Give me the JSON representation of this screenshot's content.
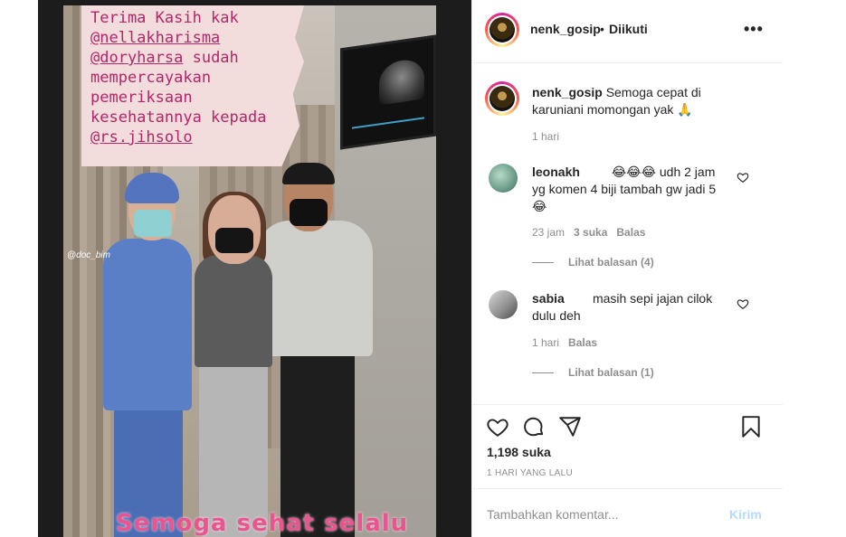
{
  "media": {
    "caption_lines": [
      "Terima Kasih kak",
      "@nellakharisma",
      "@doryharsa sudah",
      "mempercayakan",
      "pemeriksaan",
      "kesehatannya kepada",
      "@rs.jihsolo"
    ],
    "watermark": "@doc_bim",
    "bottom_text": "Semoga sehat selalu"
  },
  "header": {
    "username": "nenk_gosip",
    "separator": "•",
    "follow_status": "Diikuti",
    "more_icon": "more-horizontal-icon"
  },
  "caption": {
    "username": "nenk_gosip",
    "text": "Semoga cepat di karuniani momongan yak 🙏",
    "time": "1 hari"
  },
  "comments": [
    {
      "username": "leonakh",
      "text": "😂😂😂 udh 2 jam yg komen 4 biji tambah gw jadi 5😂",
      "time": "23 jam",
      "likes": "3 suka",
      "reply": "Balas",
      "view_replies": "Lihat balasan (4)"
    },
    {
      "username": "sabia",
      "text": "masih sepi jajan cilok dulu deh",
      "time": "1 hari",
      "reply": "Balas",
      "view_replies": "Lihat balasan (1)"
    }
  ],
  "actions": {
    "icons": [
      "heart-icon",
      "comment-icon",
      "share-icon",
      "bookmark-icon"
    ],
    "likes": "1,198 suka",
    "date": "1 HARI YANG LALU"
  },
  "add_comment": {
    "placeholder": "Tambahkan komentar...",
    "post_label": "Kirim"
  }
}
